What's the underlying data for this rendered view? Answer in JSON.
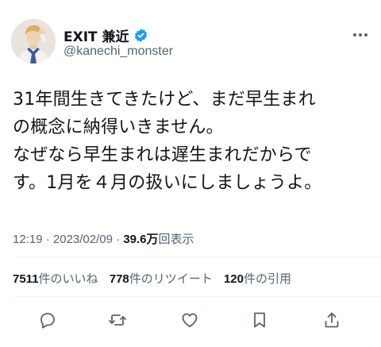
{
  "author": {
    "name": "EXIT 兼近",
    "handle": "@kanechi_monster"
  },
  "tweet": {
    "lines": [
      "31年間生きてきたけど、まだ早生まれ",
      "の概念に納得いきません。",
      "なぜなら早生まれは遅生まれだからで",
      "す。1月を４月の扱いにしましょうよ。"
    ]
  },
  "meta": {
    "time": "12:19",
    "separator": "·",
    "date": "2023/02/09",
    "views_count": "39.6万",
    "views_label": "回表示"
  },
  "stats": {
    "likes_count": "7511",
    "likes_label": "件のいいね",
    "retweets_count": "778",
    "retweets_label": "件のリツイート",
    "quotes_count": "120",
    "quotes_label": "件の引用"
  },
  "icons": {
    "more": "more-icon",
    "verified": "verified-badge-icon",
    "reply": "reply-icon",
    "retweet": "retweet-icon",
    "like": "like-icon",
    "bookmark": "bookmark-icon",
    "share": "share-icon"
  },
  "colors": {
    "text": "#0f1419",
    "secondary": "#536471",
    "verified": "#1d9bf0",
    "divider": "#eff3f4"
  }
}
